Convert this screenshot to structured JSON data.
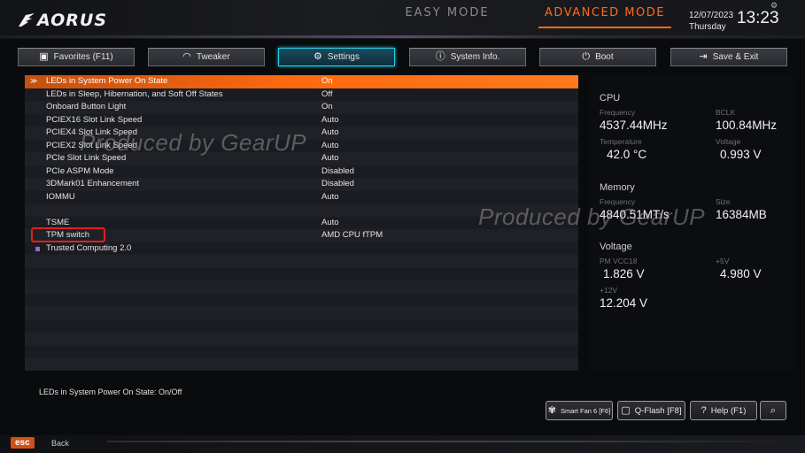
{
  "header": {
    "logo_text": "AORUS",
    "easy_mode_label": "EASY MODE",
    "advanced_mode_label": "ADVANCED MODE",
    "date": "12/07/2023",
    "day": "Thursday",
    "time": "13:23",
    "accent_color": "#ff6a1a"
  },
  "tabs": [
    {
      "label": "Favorites (F11)",
      "icon": "favorites-icon"
    },
    {
      "label": "Tweaker",
      "icon": "speedometer-icon"
    },
    {
      "label": "Settings",
      "icon": "gear-icon",
      "active": true
    },
    {
      "label": "System Info.",
      "icon": "info-icon"
    },
    {
      "label": "Boot",
      "icon": "power-icon"
    },
    {
      "label": "Save & Exit",
      "icon": "exit-icon"
    }
  ],
  "settings": [
    {
      "label": "LEDs in System Power On State",
      "value": "On",
      "selected": true
    },
    {
      "label": "LEDs in Sleep, Hibernation, and Soft Off States",
      "value": "Off"
    },
    {
      "label": "Onboard Button Light",
      "value": "On"
    },
    {
      "label": "PCIEX16 Slot Link Speed",
      "value": "Auto"
    },
    {
      "label": "PCIEX4 Slot Link Speed",
      "value": "Auto"
    },
    {
      "label": "PCIEX2 Slot Link Speed",
      "value": "Auto"
    },
    {
      "label": "PCIe Slot Link Speed",
      "value": "Auto"
    },
    {
      "label": "PCIe ASPM Mode",
      "value": "Disabled"
    },
    {
      "label": "3DMark01 Enhancement",
      "value": "Disabled"
    },
    {
      "label": "IOMMU",
      "value": "Auto"
    },
    {
      "label": "",
      "value": ""
    },
    {
      "label": "TSME",
      "value": "Auto"
    },
    {
      "label": "TPM switch",
      "value": "AMD CPU fTPM",
      "highlighted": true
    },
    {
      "label": "Trusted Computing 2.0",
      "value": "",
      "submenu": true
    }
  ],
  "help_text": "LEDs in System Power On State: On/Off",
  "info_panel": {
    "cpu": {
      "title": "CPU",
      "frequency_label": "Frequency",
      "frequency": "4537.44MHz",
      "bclk_label": "BCLK",
      "bclk": "100.84MHz",
      "temperature_label": "Temperature",
      "temperature": "42.0 °C",
      "voltage_label": "Voltage",
      "voltage": "0.993 V"
    },
    "memory": {
      "title": "Memory",
      "frequency_label": "Frequency",
      "frequency": "4840.51MT/s",
      "size_label": "Size",
      "size": "16384MB"
    },
    "voltage": {
      "title": "Voltage",
      "pm_vcc18_label": "PM VCC18",
      "pm_vcc18": "1.826 V",
      "v5_label": "+5V",
      "v5": "4.980 V",
      "v12_label": "+12V",
      "v12": "12.204 V"
    }
  },
  "bottom_buttons": {
    "smart_fan": "Smart Fan 6 [F6]",
    "qflash": "Q-Flash [F8]",
    "help": "Help (F1)"
  },
  "watermarks": [
    "Produced by GearUP",
    "Produced by GearUP"
  ],
  "footer": {
    "esc_key": "esc",
    "esc_label": "Back"
  }
}
